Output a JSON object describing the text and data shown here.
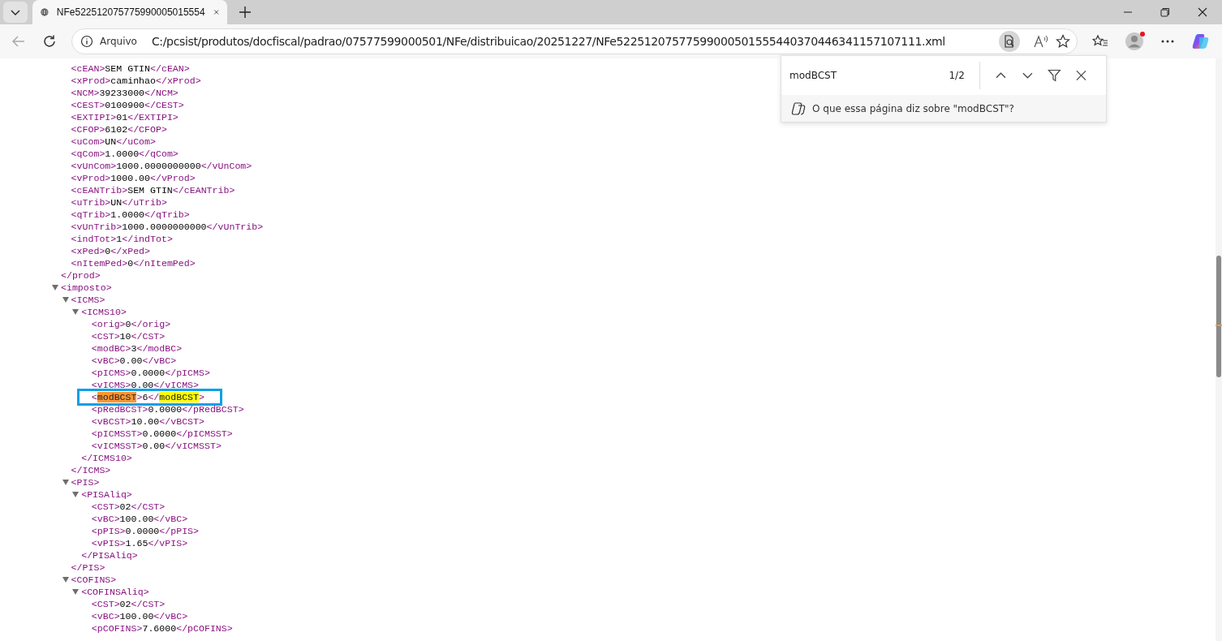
{
  "browser": {
    "tab_title": "NFe522512075775990005015554",
    "url_label": "Arquivo",
    "url": "C:/pcsist/produtos/docfiscal/padrao/07577599000501/NFe/distribuicao/20251227/NFe52251207577599000501555440370446341157107111.xml",
    "profile_notification": true
  },
  "find_bar": {
    "query": "modBCST",
    "count": "1/2",
    "ask": "O que essa página diz sobre \"modBCST\"?"
  },
  "xml": [
    {
      "close": "</prod>",
      "children": [
        {
          "open": "<cEAN>",
          "value": "SEM GTIN",
          "close": "</cEAN>"
        },
        {
          "open": "<xProd>",
          "value": "caminhao",
          "close": "</xProd>"
        },
        {
          "open": "<NCM>",
          "value": "39233000",
          "close": "</NCM>"
        },
        {
          "open": "<CEST>",
          "value": "0100900",
          "close": "</CEST>"
        },
        {
          "open": "<EXTIPI>",
          "value": "01",
          "close": "</EXTIPI>"
        },
        {
          "open": "<CFOP>",
          "value": "6102",
          "close": "</CFOP>"
        },
        {
          "open": "<uCom>",
          "value": "UN",
          "close": "</uCom>"
        },
        {
          "open": "<qCom>",
          "value": "1.0000",
          "close": "</qCom>"
        },
        {
          "open": "<vUnCom>",
          "value": "1000.0000000000",
          "close": "</vUnCom>"
        },
        {
          "open": "<vProd>",
          "value": "1000.00",
          "close": "</vProd>"
        },
        {
          "open": "<cEANTrib>",
          "value": "SEM GTIN",
          "close": "</cEANTrib>"
        },
        {
          "open": "<uTrib>",
          "value": "UN",
          "close": "</uTrib>"
        },
        {
          "open": "<qTrib>",
          "value": "1.0000",
          "close": "</qTrib>"
        },
        {
          "open": "<vUnTrib>",
          "value": "1000.0000000000",
          "close": "</vUnTrib>"
        },
        {
          "open": "<indTot>",
          "value": "1",
          "close": "</indTot>"
        },
        {
          "open": "<xPed>",
          "value": "0",
          "close": "</xPed>"
        },
        {
          "open": "<nItemPed>",
          "value": "0",
          "close": "</nItemPed>"
        }
      ]
    },
    {
      "open": "<imposto>",
      "expanded": true,
      "children": [
        {
          "open": "<ICMS>",
          "expanded": true,
          "close": "</ICMS>",
          "children": [
            {
              "open": "<ICMS10>",
              "expanded": true,
              "close": "</ICMS10>",
              "children": [
                {
                  "open": "<orig>",
                  "value": "0",
                  "close": "</orig>"
                },
                {
                  "open": "<CST>",
                  "value": "10",
                  "close": "</CST>"
                },
                {
                  "open": "<modBC>",
                  "value": "3",
                  "close": "</modBC>"
                },
                {
                  "open": "<vBC>",
                  "value": "0.00",
                  "close": "</vBC>"
                },
                {
                  "open": "<pICMS>",
                  "value": "0.0000",
                  "close": "</pICMS>"
                },
                {
                  "open": "<vICMS>",
                  "value": "0.00",
                  "close": "</vICMS>"
                },
                {
                  "open": {
                    "prefix": "<",
                    "match": "modBCST",
                    "suffix": ">",
                    "current": true
                  },
                  "value": "6",
                  "close": {
                    "prefix": "</",
                    "match": "modBCST",
                    "suffix": ">",
                    "current": false
                  },
                  "outlined": true
                },
                {
                  "open": "<pRedBCST>",
                  "value": "0.0000",
                  "close": "</pRedBCST>"
                },
                {
                  "open": "<vBCST>",
                  "value": "10.00",
                  "close": "</vBCST>"
                },
                {
                  "open": "<pICMSST>",
                  "value": "0.0000",
                  "close": "</pICMSST>"
                },
                {
                  "open": "<vICMSST>",
                  "value": "0.00",
                  "close": "</vICMSST>"
                }
              ]
            }
          ]
        },
        {
          "open": "<PIS>",
          "expanded": true,
          "close": "</PIS>",
          "children": [
            {
              "open": "<PISAliq>",
              "expanded": true,
              "close": "</PISAliq>",
              "children": [
                {
                  "open": "<CST>",
                  "value": "02",
                  "close": "</CST>"
                },
                {
                  "open": "<vBC>",
                  "value": "100.00",
                  "close": "</vBC>"
                },
                {
                  "open": "<pPIS>",
                  "value": "0.0000",
                  "close": "</pPIS>"
                },
                {
                  "open": "<vPIS>",
                  "value": "1.65",
                  "close": "</vPIS>"
                }
              ]
            }
          ]
        },
        {
          "open": "<COFINS>",
          "expanded": true,
          "children": [
            {
              "open": "<COFINSAliq>",
              "expanded": true,
              "children": [
                {
                  "open": "<CST>",
                  "value": "02",
                  "close": "</CST>"
                },
                {
                  "open": "<vBC>",
                  "value": "100.00",
                  "close": "</vBC>"
                },
                {
                  "open": "<pCOFINS>",
                  "value": "7.6000",
                  "close": "</pCOFINS>"
                }
              ]
            }
          ]
        }
      ]
    }
  ]
}
